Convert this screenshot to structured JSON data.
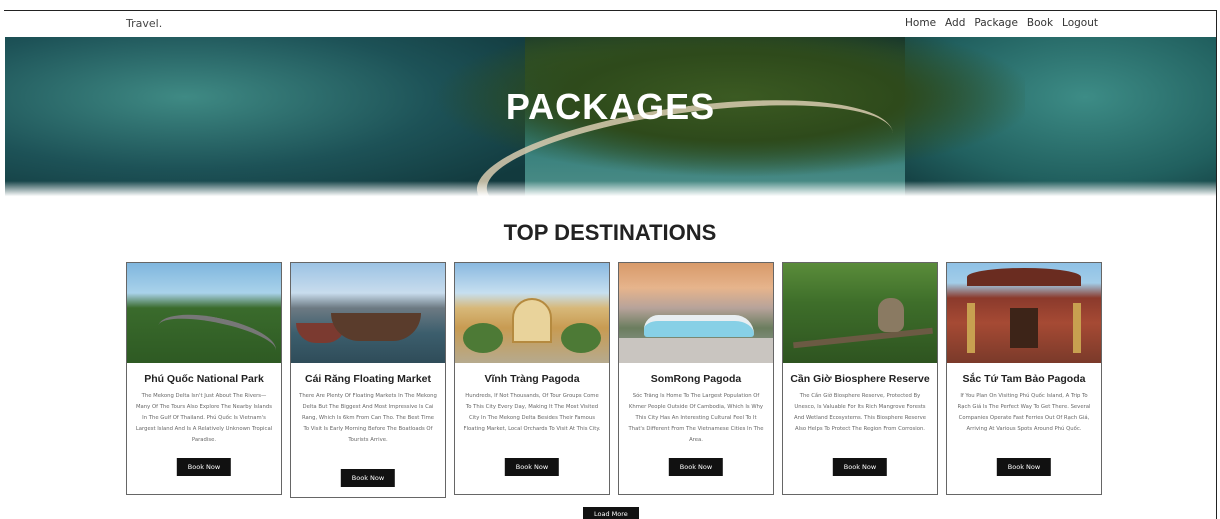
{
  "navbar": {
    "brand": "Travel.",
    "links": [
      "Home",
      "Add",
      "Package",
      "Book",
      "Logout"
    ]
  },
  "hero": {
    "title": "PACKAGES"
  },
  "section": {
    "title": "TOP DESTINATIONS"
  },
  "cards": [
    {
      "title": "Phú Quốc National Park",
      "description": "The Mekong Delta Isn't Just About The Rivers— Many Of The Tours Also Explore The Nearby Islands In The Gulf Of Thailand. Phú Quốc Is Vietnam's Largest Island And Is A Relatively Unknown Tropical Paradise.",
      "button": "Book Now",
      "image": "forest-road-photo"
    },
    {
      "title": "Cái Răng Floating Market",
      "description": "There Are Plenty Of Floating Markets In The Mekong Delta But The Biggest And Most Impressive Is Cai Rang, Which Is 6km From Can Tho. The Best Time To Visit Is Early Morning Before The Boatloads Of Tourists Arrive.",
      "button": "Book Now",
      "image": "floating-market-photo"
    },
    {
      "title": "Vĩnh Tràng Pagoda",
      "description": "Hundreds, If Not Thousands, Of Tour Groups Come To This City Every Day, Making It The Most Visited City In The Mekong Delta Besides Their Famous Floating Market, Local Orchards To Visit At This City.",
      "button": "Book Now",
      "image": "pagoda-photo"
    },
    {
      "title": "SomRong Pagoda",
      "description": "Sóc Trăng Is Home To The Largest Population Of Khmer People Outside Of Cambodia, Which Is Why This City Has An Interesting Cultural Feel To It That's Different From The Vietnamese Cities In The Area.",
      "button": "Book Now",
      "image": "reclining-buddha-photo"
    },
    {
      "title": "Cần Giờ Biosphere Reserve",
      "description": "The Cần Giờ Biosphere Reserve, Protected By Unesco, Is Valuable For Its Rich Mangrove Forests And Wetland Ecosystems. This Biosphere Reserve Also Helps To Protect The Region From Corrosion.",
      "button": "Book Now",
      "image": "monkey-photo"
    },
    {
      "title": "Sắc Tứ Tam Bảo Pagoda",
      "description": "If You Plan On Visiting Phú Quốc Island, A Trip To Rạch Giá Is The Perfect Way To Get There. Several Companies Operate Fast Ferries Out Of Rạch Giá, Arriving At Various Spots Around Phú Quốc.",
      "button": "Book Now",
      "image": "temple-photo"
    }
  ],
  "load_more": "Load More",
  "colors": {
    "button_bg": "#111111",
    "button_text": "#ffffff",
    "heading": "#222222"
  }
}
